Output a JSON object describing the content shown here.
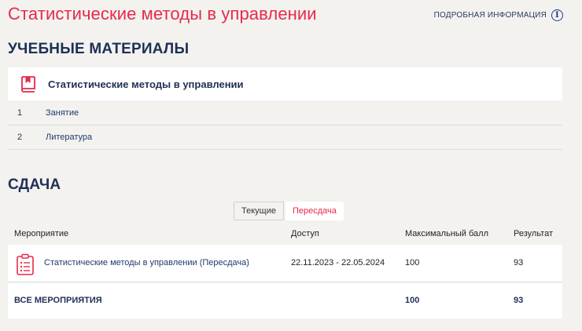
{
  "header": {
    "title": "Статистические методы в управлении",
    "more_info_label": "ПОДРОБНАЯ ИНФОРМАЦИЯ",
    "info_icon_glyph": "i"
  },
  "materials": {
    "heading": "УЧЕБНЫЕ МАТЕРИАЛЫ",
    "course_name": "Статистические методы в управлении",
    "items": [
      {
        "num": "1",
        "label": "Занятие"
      },
      {
        "num": "2",
        "label": "Литература"
      }
    ]
  },
  "submission": {
    "heading": "СДАЧА",
    "tabs": [
      {
        "label": "Текущие",
        "active": false
      },
      {
        "label": "Пересдача",
        "active": true
      }
    ],
    "columns": [
      "Мероприятие",
      "Доступ",
      "Максимальный балл",
      "Результат"
    ],
    "rows": [
      {
        "event": "Статистические методы в управлении (Пересдача)",
        "access": "22.11.2023 - 22.05.2024",
        "max_score": "100",
        "result": "93"
      }
    ],
    "total": {
      "label": "ВСЕ МЕРОПРИЯТИЯ",
      "max_score": "100",
      "result": "93"
    }
  },
  "colors": {
    "accent": "#e8294b",
    "navy": "#1f2f56",
    "background": "#f3f2ef"
  }
}
